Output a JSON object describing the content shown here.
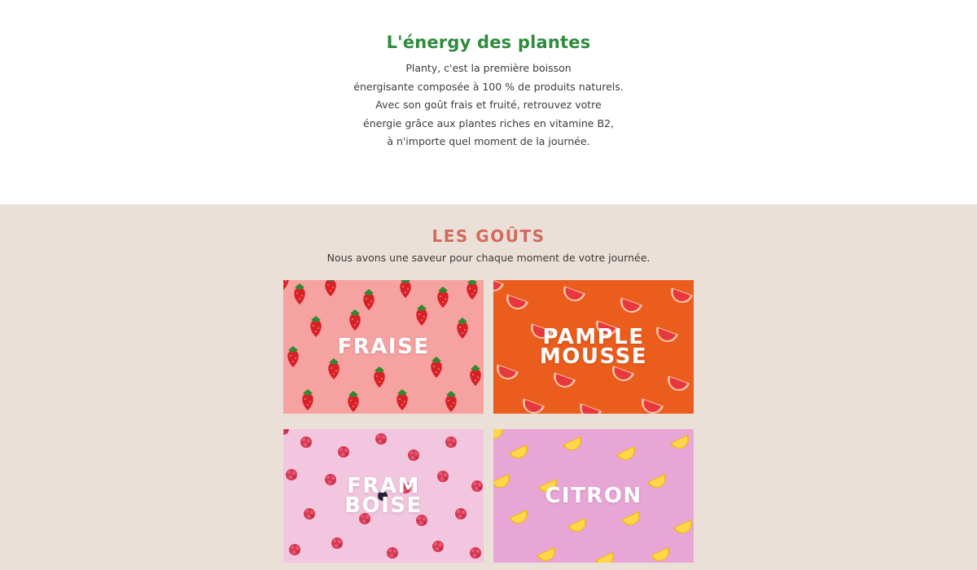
{
  "hero": {
    "title": "L'énergy des plantes",
    "intro_lines": [
      "Planty, c'est la première boisson",
      "énergisante composée à 100 % de produits naturels.",
      "Avec son goût frais et fruité, retrouvez votre",
      "énergie grâce aux plantes riches en vitamine B2,",
      "à n'importe quel moment de la journée."
    ]
  },
  "flavors": {
    "title": "LES GOÛTS",
    "subtitle": "Nous avons une saveur pour chaque moment de votre journée.",
    "cards": [
      {
        "label": "FRAISE",
        "bg": "#f6a2a1",
        "fruit": "strawberry-icon"
      },
      {
        "label": "PAMPLE\nMOUSSE",
        "bg": "#ea5d1c",
        "fruit": "grapefruit-icon"
      },
      {
        "label": "FRAM\nBOISE",
        "bg": "#f1c6de",
        "fruit": "raspberry-icon"
      },
      {
        "label": "CITRON",
        "bg": "#e8a6d7",
        "fruit": "lemon-icon"
      }
    ]
  },
  "colors": {
    "title_green": "#2e8b3d",
    "title_coral": "#d26b5e",
    "section_bg": "#ebe0d7"
  }
}
